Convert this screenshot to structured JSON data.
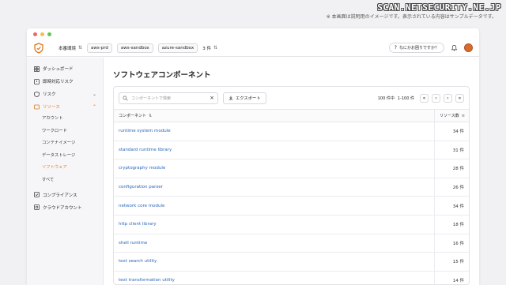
{
  "watermark": "SCAN.NETSECURITY.NE.JP",
  "notice": "※ 本画面は説明用のイメージです。表示されている内容はサンプルデータです。",
  "colors": {
    "accent": "#e0761c",
    "link": "#2b66b8",
    "dot_red": "#ec6a5e",
    "dot_yellow": "#f4bf4f",
    "dot_green": "#61c554"
  },
  "topbar": {
    "environment": "本番環境",
    "chips": [
      "aws-prd",
      "aws-sandbox",
      "azure-sandbox"
    ],
    "count": "3 件",
    "help": "なにかお困りですか？"
  },
  "sidebar": {
    "items": [
      {
        "label": "ダッシュボード",
        "icon": "dashboard-icon"
      },
      {
        "label": "即時対応リスク",
        "icon": "alert-icon"
      },
      {
        "label": "リスク",
        "icon": "risk-icon"
      },
      {
        "label": "リソース",
        "icon": "resource-icon"
      },
      {
        "label": "コンプライアンス",
        "icon": "compliance-icon"
      },
      {
        "label": "クラウドアカウント",
        "icon": "cloud-account-icon"
      }
    ],
    "sub_items": [
      "アカウント",
      "ワークロード",
      "コンテナイメージ",
      "データストレージ",
      "ソフトウェア",
      "すべて"
    ]
  },
  "main": {
    "title": "ソフトウェアコンポーネント",
    "search_placeholder": "コンポーネントで検索",
    "export_label": "エクスポート",
    "pager": {
      "total": "100 件中",
      "range": "1-100 件"
    },
    "columns": {
      "name": "コンポーネント",
      "count": "リソース数"
    },
    "rows": [
      {
        "name": "runtime system module",
        "count": "34 件"
      },
      {
        "name": "standard runtime library",
        "count": "31 件"
      },
      {
        "name": "cryptography module",
        "count": "28 件"
      },
      {
        "name": "configuration parser",
        "count": "26 件"
      },
      {
        "name": "network core module",
        "count": "34 件"
      },
      {
        "name": "http client library",
        "count": "18 件"
      },
      {
        "name": "shell runtime",
        "count": "16 件"
      },
      {
        "name": "text search utility",
        "count": "15 件"
      },
      {
        "name": "text transformation utility",
        "count": "14 件"
      }
    ]
  }
}
